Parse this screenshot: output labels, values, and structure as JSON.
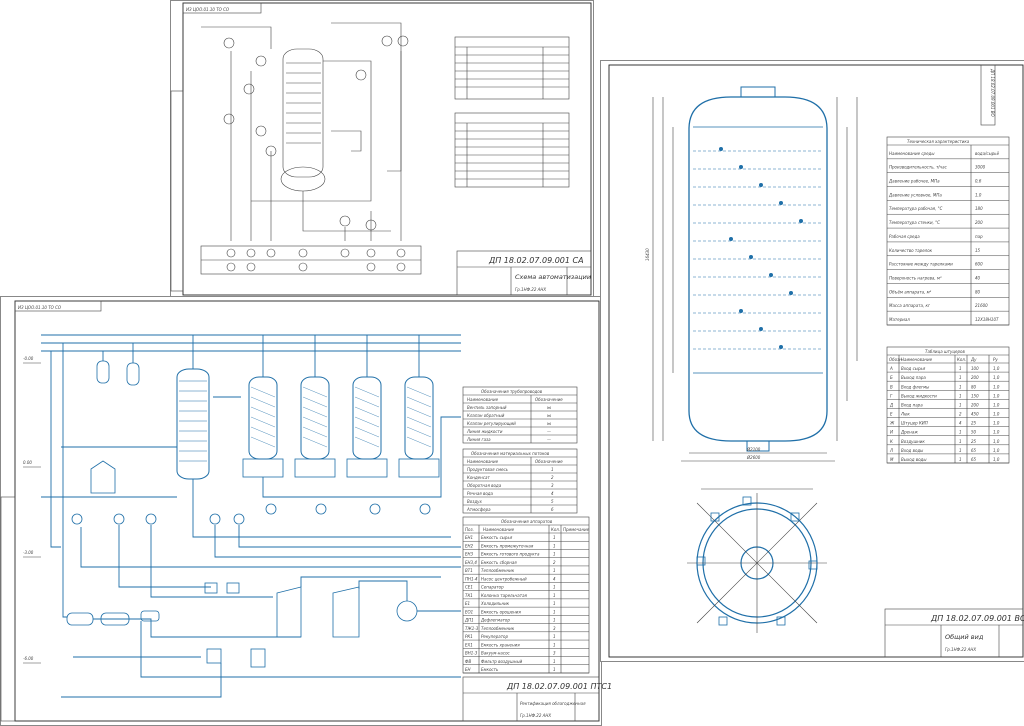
{
  "colors": {
    "pipe": "#1f6fa8",
    "frame": "#222222",
    "hatch": "#1f6fa8"
  },
  "sheet_top": {
    "corner_stamp": "ИЗ ЦОО.01.10 ТО СО",
    "title_code": "ДП 18.02.07.09.001 СА",
    "title_name": "Схема автоматизации",
    "org": "Гр.1НФ.22 АНХ"
  },
  "sheet_left": {
    "corner_stamp": "ИЗ ЦОО.01.10 ТО СО",
    "title_code": "ДП 18.02.07.09.001 ПТС1",
    "title_name": "Ректификация облагодженная",
    "org": "Гр.1НФ.22 АНХ",
    "scale_marks": [
      "-0.00",
      "0.00",
      "-3.00",
      "-6.00"
    ],
    "legend_pipes_title": "Обозначения трубопроводов",
    "legend_pipes_header": [
      "Наименование",
      "Обозначение"
    ],
    "legend_pipes": [
      [
        "Вентиль запорный",
        "⋈"
      ],
      [
        "Клапан обратный",
        "⋈"
      ],
      [
        "Клапан регулирующий",
        "⋈"
      ],
      [
        "Линия жидкости",
        "—"
      ],
      [
        "Линия газа",
        "—"
      ]
    ],
    "legend_pipes2_title": "Обозначения материальных потоков",
    "legend_pipes2_header": [
      "Наименование",
      "Обозначение"
    ],
    "legend_pipes2": [
      [
        "Продуктовая смесь",
        "1"
      ],
      [
        "Конденсат",
        "2"
      ],
      [
        "Оборотная вода",
        "3"
      ],
      [
        "Речная вода",
        "4"
      ],
      [
        "Воздух",
        "5"
      ],
      [
        "Атмосфера",
        "6"
      ]
    ],
    "equip_title": "Обозначения аппаратов",
    "equip_header": [
      "Поз.",
      "Наименование",
      "Кол.",
      "Примечание"
    ],
    "equip": [
      [
        "ЕН1",
        "Емкость сырья",
        "1",
        ""
      ],
      [
        "ЕН2",
        "Емкость промежуточная",
        "1",
        ""
      ],
      [
        "ЕН3",
        "Емкость готового продукта",
        "1",
        ""
      ],
      [
        "ЕН3,4",
        "Емкость сборная",
        "2",
        ""
      ],
      [
        "ВТ1",
        "Теплообменник",
        "1",
        ""
      ],
      [
        "ПН1-4",
        "Насос центробежный",
        "4",
        ""
      ],
      [
        "СЕ1",
        "Сепаратор",
        "1",
        ""
      ],
      [
        "ТК1",
        "Колонна тарельчатая",
        "1",
        ""
      ],
      [
        "Е1",
        "Холодильник",
        "1",
        ""
      ],
      [
        "ЕО1",
        "Емкость орошения",
        "1",
        ""
      ],
      [
        "ДП1",
        "Дефлегматор",
        "1",
        ""
      ],
      [
        "ТЖ1-3",
        "Теплообменник",
        "3",
        ""
      ],
      [
        "РК1",
        "Рекуператор",
        "1",
        ""
      ],
      [
        "ЕХ1",
        "Емкость хранения",
        "1",
        ""
      ],
      [
        "ВН1-3",
        "Вакуум-насос",
        "3",
        ""
      ],
      [
        "ФВ",
        "Фильтр воздушный",
        "1",
        ""
      ],
      [
        "ЕН",
        "Емкость",
        "1",
        ""
      ]
    ]
  },
  "sheet_right": {
    "corner_stamp": "ДП 18.02.07.09.001 ВО",
    "title_code": "ДП 18.02.07.09.001 ВО",
    "title_name": "Общий вид",
    "org": "Гр.1НФ.22 АНХ",
    "dim_outer": "Ø2600",
    "dim_inner": "Ø2100",
    "dim_height": "16430",
    "tech_title": "Техническая характеристика",
    "tech": [
      [
        "Наименование среды",
        "вода/сырьё"
      ],
      [
        "Производительность, т/час",
        "3000"
      ],
      [
        "Давление рабочее, МПа",
        "0,6"
      ],
      [
        "Давление условное, МПа",
        "1,0"
      ],
      [
        "Температура рабочая, °С",
        "180"
      ],
      [
        "Температура стенки, °С",
        "200"
      ],
      [
        "Рабочая среда",
        "пар"
      ],
      [
        "Количество тарелок",
        "15"
      ],
      [
        "Расстояние между тарелками",
        "600"
      ],
      [
        "Поверхность нагрева, м²",
        "40"
      ],
      [
        "Объём аппарата, м³",
        "80"
      ],
      [
        "Масса аппарата, кг",
        "21600"
      ],
      [
        "Материал",
        "12Х18Н10Т"
      ]
    ],
    "nozzles_title": "Таблица штуцеров",
    "nozzles_header": [
      "Обозн.",
      "Наименование",
      "Кол.",
      "Ду",
      "Ру"
    ],
    "nozzles": [
      [
        "А",
        "Вход сырья",
        "1",
        "100",
        "1,0"
      ],
      [
        "Б",
        "Выход пара",
        "1",
        "200",
        "1,0"
      ],
      [
        "В",
        "Вход флегмы",
        "1",
        "80",
        "1,0"
      ],
      [
        "Г",
        "Выход жидкости",
        "1",
        "150",
        "1,0"
      ],
      [
        "Д",
        "Вход пара",
        "1",
        "200",
        "1,0"
      ],
      [
        "Е",
        "Люк",
        "2",
        "450",
        "1,0"
      ],
      [
        "Ж",
        "Штуцер КИП",
        "4",
        "25",
        "1,0"
      ],
      [
        "И",
        "Дренаж",
        "1",
        "50",
        "1,0"
      ],
      [
        "К",
        "Воздушник",
        "1",
        "25",
        "1,0"
      ],
      [
        "Л",
        "Вход воды",
        "1",
        "65",
        "1,0"
      ],
      [
        "М",
        "Выход воды",
        "1",
        "65",
        "1,0"
      ]
    ]
  }
}
